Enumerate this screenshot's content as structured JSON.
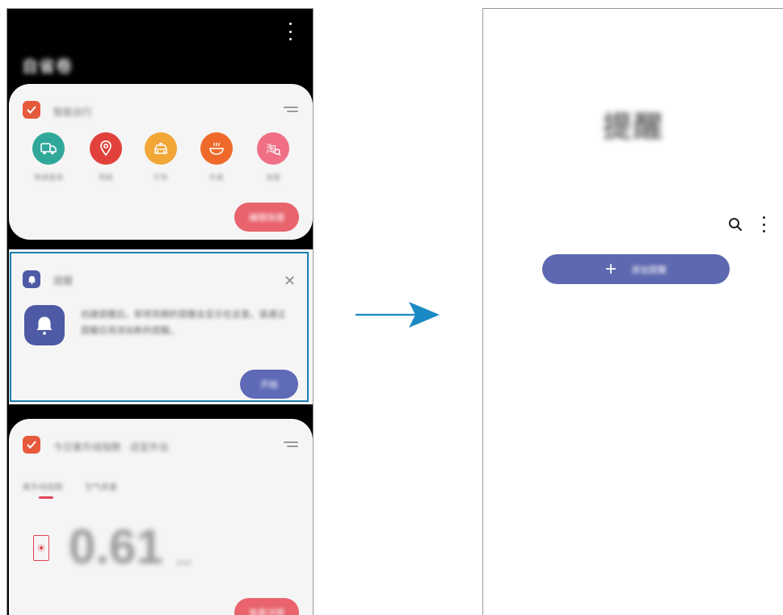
{
  "left_screen": {
    "title": "自省卷",
    "card_shortcuts": {
      "title": "智能出行",
      "items": [
        {
          "label": "快递查询",
          "icon": "delivery-truck-icon",
          "color": "#2fa89a"
        },
        {
          "label": "导航",
          "icon": "location-pin-icon",
          "color": "#e2413b"
        },
        {
          "label": "打车",
          "icon": "taxi-icon",
          "color": "#f1a636"
        },
        {
          "label": "外卖",
          "icon": "food-bowl-icon",
          "color": "#ef6a2a"
        },
        {
          "label": "淘宝",
          "icon": "taobao-icon",
          "color": "#f06f86"
        }
      ],
      "action_label": "编辑快捷"
    },
    "card_reminder": {
      "title": "提醒",
      "body": "创建提醒后，即将到期的提醒会显示在这里。请通过提醒应用添加新的提醒。",
      "button_label": "开始",
      "close_glyph": "✕"
    },
    "card_uv": {
      "title": "今日紫外线指数 · 适宜外出",
      "tabs": [
        "紫外线指数",
        "空气质量"
      ],
      "value": "0.61",
      "unit": "UVI",
      "action_label": "查看详情"
    }
  },
  "right_screen": {
    "title": "提醒",
    "add_button_label": "添加提醒",
    "plus_glyph": "+"
  },
  "colors": {
    "accent_blue": "#5e68b0",
    "accent_red": "#e8636c",
    "frame_blue": "#1b7fb0",
    "arrow_blue": "#1a8ac4"
  }
}
